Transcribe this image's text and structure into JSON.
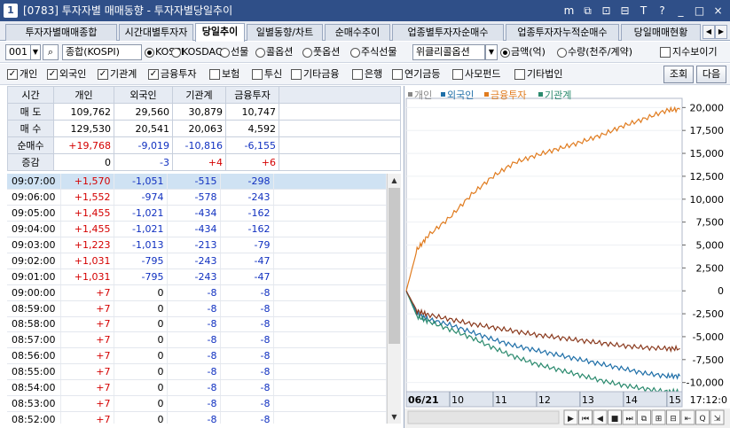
{
  "window": {
    "number": "1",
    "title": "[0783]  투자자별 매매동향 - 투자자별당일추이",
    "buttons": [
      "m",
      "⧉",
      "⊡",
      "⊟",
      "T",
      "?",
      "_",
      "□",
      "×"
    ]
  },
  "tabs": [
    "투자자별매매종합",
    "시간대별투자자",
    "당일추이",
    "일별동향/차트",
    "순매수추이",
    "업종별투자자순매수",
    "업종투자자누적순매수",
    "당일매매현황"
  ],
  "active_tab": "당일추이",
  "toolbar": {
    "code": "001",
    "market_name": "종합(KOSPI)",
    "market_radios": [
      {
        "label": "KOSPI",
        "on": true
      },
      {
        "label": "KOSDAQ",
        "on": false
      },
      {
        "label": "선물",
        "on": false
      },
      {
        "label": "콜옵션",
        "on": false
      },
      {
        "label": "풋옵션",
        "on": false
      },
      {
        "label": "주식선물",
        "on": false
      }
    ],
    "option_select": "위클리콜옵션",
    "unit_radios": [
      {
        "label": "금액(억)",
        "on": true
      },
      {
        "label": "수량(천주/계약)",
        "on": false
      }
    ],
    "fit_label": "지수보이기"
  },
  "filters": [
    {
      "label": "개인",
      "on": true
    },
    {
      "label": "외국인",
      "on": true
    },
    {
      "label": "기관계",
      "on": true
    },
    {
      "label": "금융투자",
      "on": true
    },
    {
      "label": "보험",
      "on": false
    },
    {
      "label": "투신",
      "on": false
    },
    {
      "label": "기타금융",
      "on": false
    },
    {
      "label": "은행",
      "on": false
    },
    {
      "label": "연기금등",
      "on": false
    },
    {
      "label": "사모펀드",
      "on": false
    },
    {
      "label": "기타법인",
      "on": false
    }
  ],
  "buttons": {
    "query": "조회",
    "next": "다음"
  },
  "summary": {
    "headers": [
      "시간",
      "개인",
      "외국인",
      "기관계",
      "금융투자"
    ],
    "rows": [
      {
        "label": "매 도",
        "values": [
          "109,762",
          "29,560",
          "30,879",
          "10,747"
        ],
        "colors": [
          "",
          "",
          "",
          ""
        ]
      },
      {
        "label": "매 수",
        "values": [
          "129,530",
          "20,541",
          "20,063",
          "4,592"
        ],
        "colors": [
          "",
          "",
          "",
          ""
        ]
      },
      {
        "label": "순매수",
        "values": [
          "+19,768",
          "-9,019",
          "-10,816",
          "-6,155"
        ],
        "colors": [
          "red",
          "blue",
          "blue",
          "blue"
        ]
      },
      {
        "label": "증감",
        "values": [
          "0",
          "-3",
          "+4",
          "+6"
        ],
        "colors": [
          "",
          "blue",
          "red",
          "red"
        ]
      }
    ]
  },
  "time_rows": [
    [
      "09:07:00",
      "+1,570",
      "-1,051",
      "-515",
      "-298"
    ],
    [
      "09:06:00",
      "+1,552",
      "-974",
      "-578",
      "-243"
    ],
    [
      "09:05:00",
      "+1,455",
      "-1,021",
      "-434",
      "-162"
    ],
    [
      "09:04:00",
      "+1,455",
      "-1,021",
      "-434",
      "-162"
    ],
    [
      "09:03:00",
      "+1,223",
      "-1,013",
      "-213",
      "-79"
    ],
    [
      "09:02:00",
      "+1,031",
      "-795",
      "-243",
      "-47"
    ],
    [
      "09:01:00",
      "+1,031",
      "-795",
      "-243",
      "-47"
    ],
    [
      "09:00:00",
      "+7",
      "0",
      "-8",
      "-8"
    ],
    [
      "08:59:00",
      "+7",
      "0",
      "-8",
      "-8"
    ],
    [
      "08:58:00",
      "+7",
      "0",
      "-8",
      "-8"
    ],
    [
      "08:57:00",
      "+7",
      "0",
      "-8",
      "-8"
    ],
    [
      "08:56:00",
      "+7",
      "0",
      "-8",
      "-8"
    ],
    [
      "08:55:00",
      "+7",
      "0",
      "-8",
      "-8"
    ],
    [
      "08:54:00",
      "+7",
      "0",
      "-8",
      "-8"
    ],
    [
      "08:53:00",
      "+7",
      "0",
      "-8",
      "-8"
    ],
    [
      "08:52:00",
      "+7",
      "0",
      "-8",
      "-8"
    ]
  ],
  "chart_data": {
    "type": "line",
    "legend": "top-left",
    "date_label": "06/21",
    "time_label": "17:12:0",
    "x_ticks": [
      "10",
      "11",
      "12",
      "13",
      "14",
      "15"
    ],
    "ylim": [
      -11000,
      21000
    ],
    "y_ticks": [
      "20,000",
      "17,500",
      "15,000",
      "12,500",
      "10,000",
      "7,500",
      "5,000",
      "2,500",
      "0",
      "-2,500",
      "-5,000",
      "-7,500",
      "-10,000"
    ],
    "x_hours": [
      9,
      9.25,
      9.5,
      10,
      10.5,
      11,
      11.5,
      12,
      12.5,
      13,
      13.5,
      14,
      14.5,
      15,
      15.3
    ],
    "series": [
      {
        "name": "개인",
        "color": "#888888",
        "values": []
      },
      {
        "name": "외국인",
        "color": "#1f6fa8",
        "values": [
          0,
          -2500,
          -3100,
          -3700,
          -4500,
          -5300,
          -6000,
          -6500,
          -7000,
          -7500,
          -8000,
          -8500,
          -9000,
          -9300,
          -9300
        ]
      },
      {
        "name": "금융투자",
        "color": "#e07b1e",
        "values": [
          0,
          4500,
          6000,
          8000,
          10500,
          12500,
          14000,
          14800,
          15500,
          16200,
          17000,
          18000,
          18800,
          19700,
          19800
        ]
      },
      {
        "name": "기관계",
        "color": "#2b8a6e",
        "values": [
          0,
          -2800,
          -3300,
          -4200,
          -5100,
          -6200,
          -7200,
          -8000,
          -8600,
          -9200,
          -9800,
          -10300,
          -10700,
          -11000,
          -11000
        ]
      },
      {
        "name": "",
        "color": "#8a3a1e",
        "values": [
          0,
          -2200,
          -2600,
          -3100,
          -3600,
          -4000,
          -4400,
          -4800,
          -5100,
          -5400,
          -5700,
          -6000,
          -6200,
          -6300,
          -6300
        ]
      }
    ]
  },
  "chart_nav": [
    "▶",
    "⏮",
    "◀",
    "■",
    "⏭",
    "⧉",
    "⊞",
    "⊟",
    "⇤",
    "Q",
    "⇲"
  ]
}
